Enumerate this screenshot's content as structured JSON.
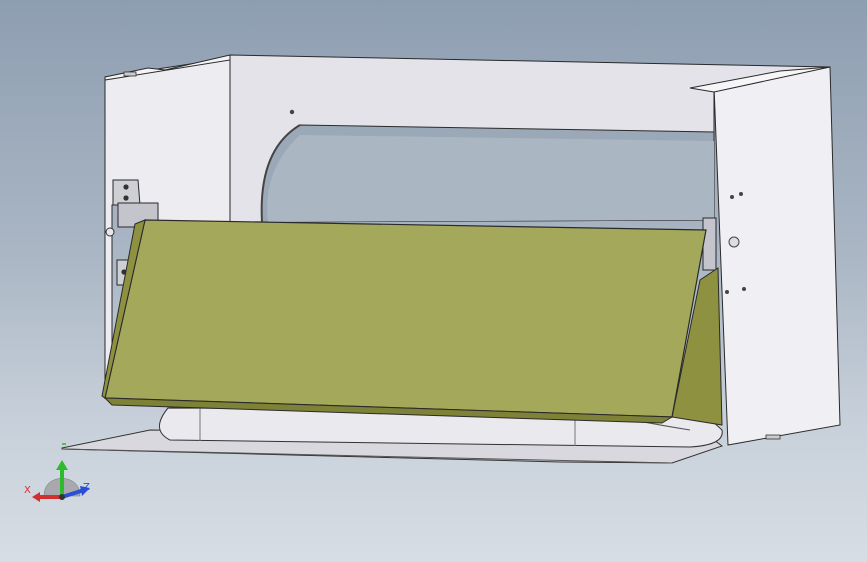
{
  "viewport": {
    "background_top": "#8e9eb1",
    "background_bottom": "#d7dde4"
  },
  "model": {
    "frame_color": "#e4e4ea",
    "panel_color": "#a4a85a",
    "panel_dark_color": "#8d9140",
    "edge_color": "#2a2a2a"
  },
  "triad": {
    "x_label": "X",
    "y_label": "",
    "z_label": "Z",
    "x_color": "#d23030",
    "y_color": "#2dbb2d",
    "z_color": "#2a4fd6"
  }
}
